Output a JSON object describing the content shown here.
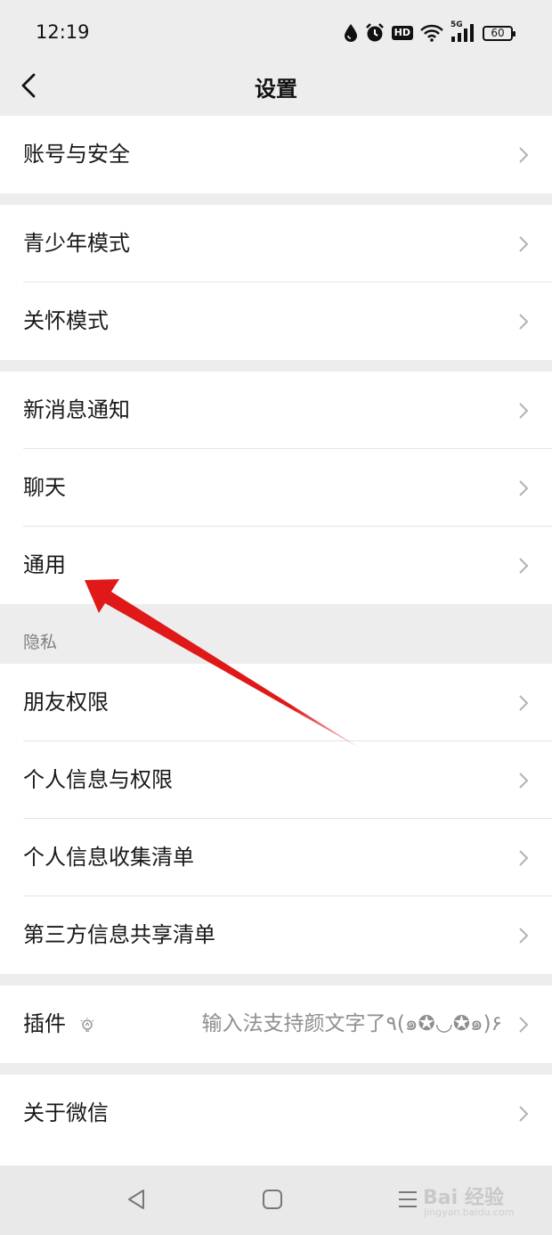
{
  "status_bar": {
    "time": "12:19",
    "hd": "HD",
    "network": "5G",
    "battery": "60",
    "icons": [
      "drop-icon",
      "alarm-icon",
      "hd-icon",
      "wifi-icon",
      "signal-5g-icon",
      "battery-icon"
    ]
  },
  "nav": {
    "title": "设置"
  },
  "groups": {
    "account": {
      "label": "账号与安全"
    },
    "youth": {
      "label": "青少年模式"
    },
    "care": {
      "label": "关怀模式"
    },
    "notify": {
      "label": "新消息通知"
    },
    "chat": {
      "label": "聊天"
    },
    "general": {
      "label": "通用"
    },
    "privacy_title": "隐私",
    "friends": {
      "label": "朋友权限"
    },
    "personal": {
      "label": "个人信息与权限"
    },
    "collect": {
      "label": "个人信息收集清单"
    },
    "thirdparty": {
      "label": "第三方信息共享清单"
    },
    "plugin": {
      "label": "插件",
      "desc": "输入法支持颜文字了٩(๑✪◡✪๑)۶"
    },
    "about": {
      "label": "关于微信"
    }
  },
  "watermark": {
    "main": "Bai 经验",
    "sub": "jingyan.baidu.com"
  },
  "colors": {
    "background": "#ededed",
    "card": "#ffffff",
    "arrow": "#e01818",
    "chevron": "#b2b2b2"
  }
}
